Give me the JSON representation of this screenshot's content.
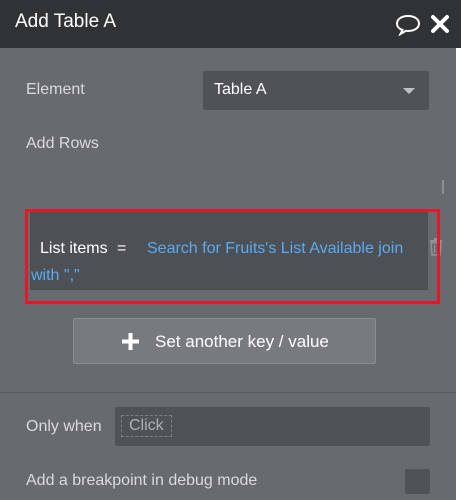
{
  "header": {
    "title": "Add Table A"
  },
  "element": {
    "label": "Element",
    "value": "Table A"
  },
  "add_rows_label": "Add Rows",
  "row": {
    "key": "List items",
    "equals": "=",
    "value_line1": "Search for Fruits's List Available join",
    "value_line2": "with \",\""
  },
  "add_button_label": "Set another key / value",
  "only_when": {
    "label": "Only when",
    "placeholder": "Click"
  },
  "breakpoint_label": "Add a breakpoint in debug mode",
  "colors": {
    "highlight": "#e3192a",
    "expression": "#5aaaf0",
    "header_bg": "#2f3336"
  }
}
